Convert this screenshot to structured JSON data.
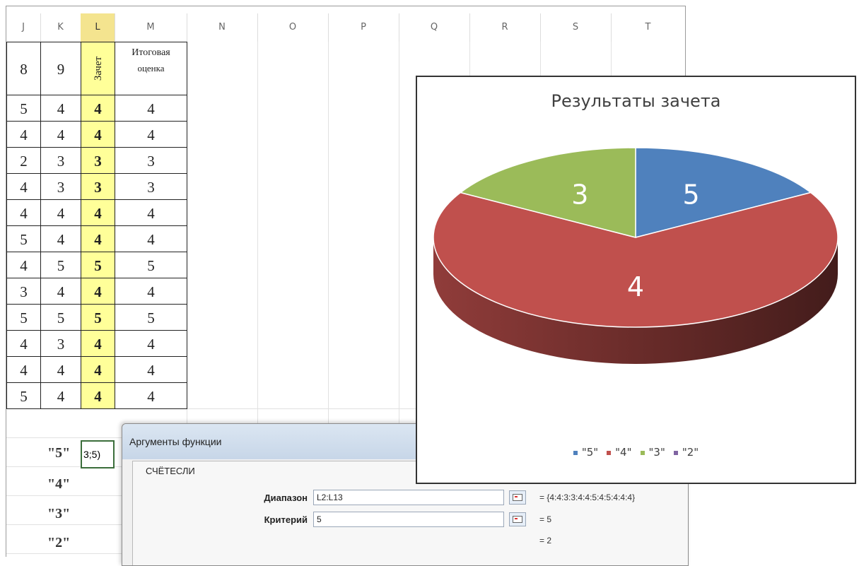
{
  "sheet": {
    "columns": [
      "J",
      "K",
      "L",
      "M",
      "N",
      "O",
      "P",
      "Q",
      "R",
      "S",
      "T"
    ],
    "selected_column": "L",
    "header_row": {
      "j": "8",
      "k": "9",
      "l": "Зачет",
      "m_line1": "Итоговая",
      "m_line2": "оценка"
    },
    "rows": [
      [
        "5",
        "4",
        "4",
        "4"
      ],
      [
        "4",
        "4",
        "4",
        "4"
      ],
      [
        "2",
        "3",
        "3",
        "3"
      ],
      [
        "4",
        "3",
        "3",
        "3"
      ],
      [
        "4",
        "4",
        "4",
        "4"
      ],
      [
        "5",
        "4",
        "4",
        "4"
      ],
      [
        "4",
        "5",
        "5",
        "5"
      ],
      [
        "3",
        "4",
        "4",
        "4"
      ],
      [
        "5",
        "5",
        "5",
        "5"
      ],
      [
        "4",
        "3",
        "4",
        "4"
      ],
      [
        "4",
        "4",
        "4",
        "4"
      ],
      [
        "5",
        "4",
        "4",
        "4"
      ]
    ],
    "criteria_labels": [
      "\"5\"",
      "\"4\"",
      "\"3\"",
      "\"2\""
    ],
    "active_cell_text": "3;5)"
  },
  "dialog": {
    "title": "Аргументы функции",
    "function_name": "СЧЁТЕСЛИ",
    "args": [
      {
        "label": "Диапазон",
        "value": "L2:L13",
        "result": "= {4:4:3:3:4:4:5:4:5:4:4:4}"
      },
      {
        "label": "Критерий",
        "value": "5",
        "result": "= 5"
      }
    ],
    "final_result": "= 2"
  },
  "chart_data": {
    "type": "pie",
    "title": "Результаты зачета",
    "categories": [
      "\"5\"",
      "\"4\"",
      "\"3\"",
      "\"2\""
    ],
    "values": [
      2,
      8,
      2,
      0
    ],
    "slice_labels": [
      "5",
      "4",
      "3",
      ""
    ],
    "colors": [
      "#4f81bd",
      "#c0504d",
      "#9bbb59",
      "#8064a2"
    ],
    "legend": "bottom"
  }
}
